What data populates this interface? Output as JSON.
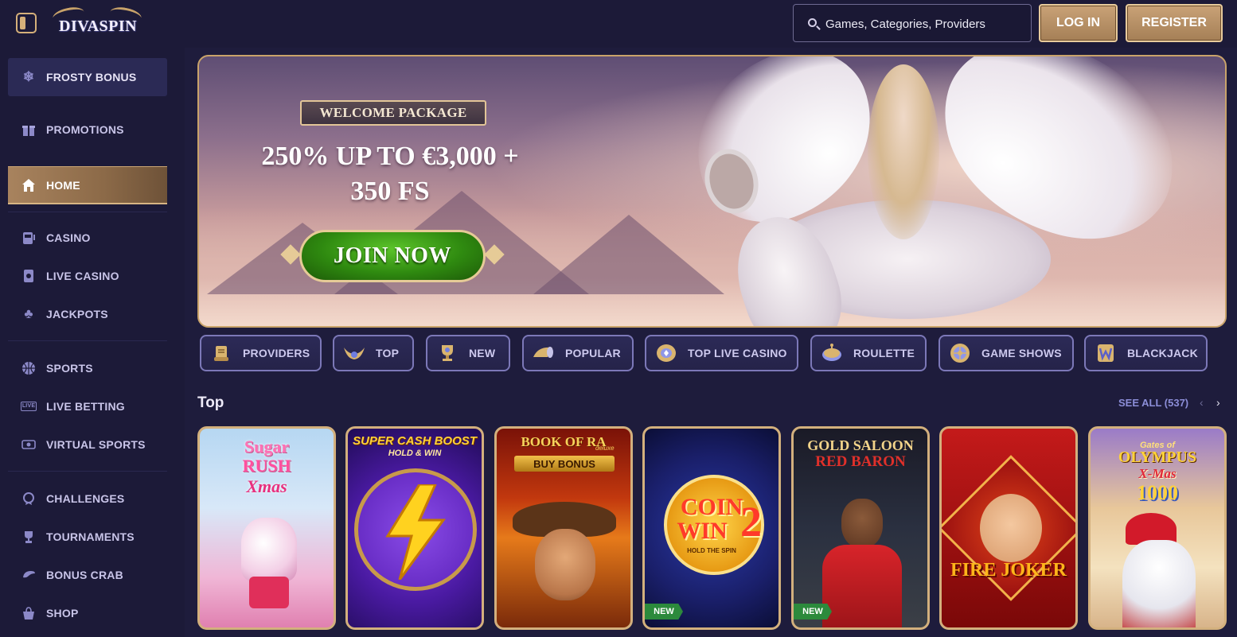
{
  "header": {
    "logo_text": "DIVASPIN",
    "search_placeholder": "Games, Categories, Providers",
    "login_label": "LOG IN",
    "register_label": "REGISTER"
  },
  "sidebar": {
    "items": [
      {
        "label": "FROSTY BONUS",
        "icon": "snowflake-icon"
      },
      {
        "label": "PROMOTIONS",
        "icon": "gift-icon"
      },
      {
        "label": "HOME",
        "icon": "home-icon"
      },
      {
        "label": "CASINO",
        "icon": "slot-machine-icon"
      },
      {
        "label": "LIVE CASINO",
        "icon": "cards-icon"
      },
      {
        "label": "JACKPOTS",
        "icon": "clover-icon"
      },
      {
        "label": "SPORTS",
        "icon": "basketball-icon"
      },
      {
        "label": "LIVE BETTING",
        "icon": "live-icon"
      },
      {
        "label": "VIRTUAL SPORTS",
        "icon": "gamepad-icon"
      },
      {
        "label": "CHALLENGES",
        "icon": "medal-icon"
      },
      {
        "label": "TOURNAMENTS",
        "icon": "trophy-icon"
      },
      {
        "label": "BONUS CRAB",
        "icon": "crab-icon"
      },
      {
        "label": "SHOP",
        "icon": "basket-icon"
      }
    ],
    "live_badge": "LIVE"
  },
  "banner": {
    "pill": "WELCOME PACKAGE",
    "offer_line1": "250% UP TO €3,000 +",
    "offer_line2": "350 FS",
    "cta": "JOIN NOW"
  },
  "categories": [
    {
      "label": "PROVIDERS",
      "icon": "scroll-icon"
    },
    {
      "label": "TOP",
      "icon": "winged-helmet-icon"
    },
    {
      "label": "NEW",
      "icon": "trophy-cup-icon"
    },
    {
      "label": "POPULAR",
      "icon": "horn-icon"
    },
    {
      "label": "TOP LIVE CASINO",
      "icon": "coin-stack-icon"
    },
    {
      "label": "ROULETTE",
      "icon": "roulette-icon"
    },
    {
      "label": "GAME SHOWS",
      "icon": "wheel-icon"
    },
    {
      "label": "BLACKJACK",
      "icon": "w-card-icon"
    }
  ],
  "top_section": {
    "title": "Top",
    "see_all": "SEE ALL (537)"
  },
  "games": [
    {
      "l1": "Sugar",
      "l2": "RUSH",
      "l3": "Xmas"
    },
    {
      "l1": "SUPER CASH BOOST",
      "l2": "HOLD & WIN"
    },
    {
      "l1": "BOOK OF RA",
      "l2": "deluxe",
      "l3": "BUY BONUS"
    },
    {
      "l1": "COIN",
      "l2": "WIN",
      "l3": "2",
      "l4": "HOLD THE SPIN",
      "badge": "NEW"
    },
    {
      "l1": "GOLD SALOON",
      "l2": "RED BARON",
      "badge": "NEW"
    },
    {
      "l1": "FIRE JOKER"
    },
    {
      "l1": "Gates of",
      "l2": "OLYMPUS",
      "l3": "X-Mas",
      "l4": "1000"
    }
  ],
  "colors": {
    "background": "#1e1c3c",
    "gold": "#c9a36a",
    "cta_green": "#2f8a10",
    "link_blue": "#8c8ed8"
  }
}
